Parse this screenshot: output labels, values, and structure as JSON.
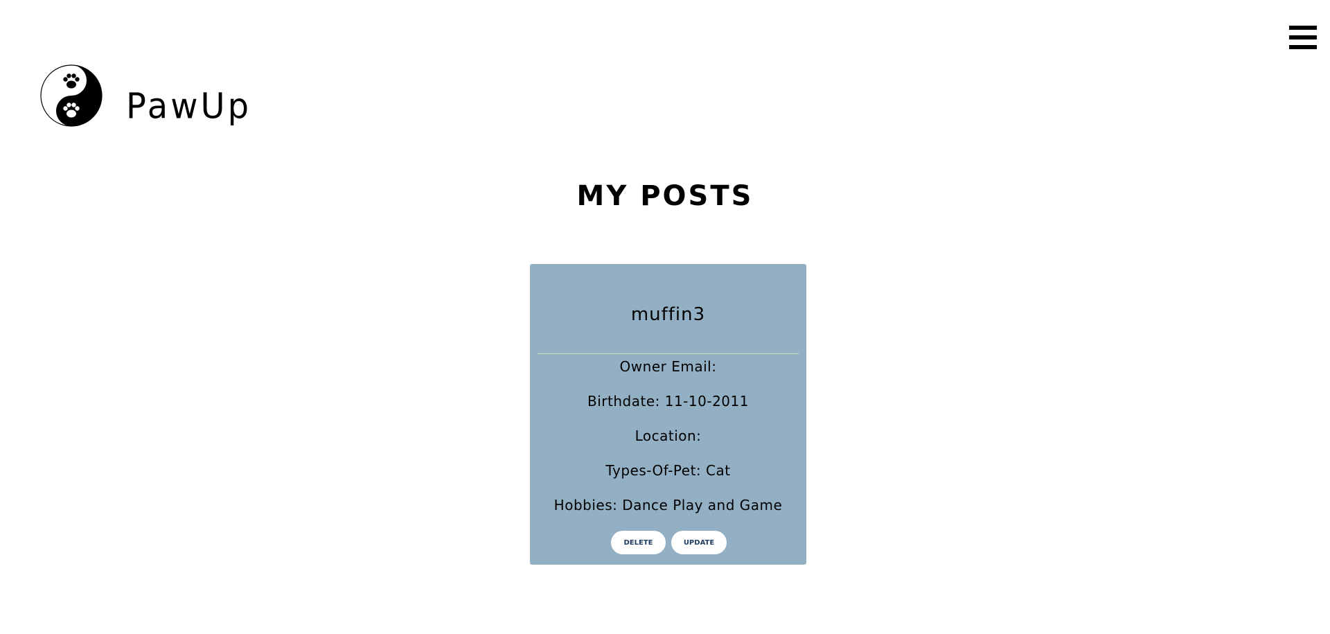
{
  "header": {
    "brand": "PawUp",
    "menu_icon": "hamburger-menu-icon",
    "logo_icon": "yin-yang-paw-logo-icon"
  },
  "page": {
    "title": "MY POSTS"
  },
  "posts": [
    {
      "name": "muffin3",
      "owner_email_label": "Owner Email:",
      "owner_email": "",
      "birthdate_label": "Birthdate: ",
      "birthdate": "11-10-2011",
      "location_label": "Location:",
      "location": "",
      "type_label": "Types-Of-Pet: ",
      "type": "Cat",
      "hobbies_label": "Hobbies: ",
      "hobbies": "Dance Play and Game",
      "delete_label": "DELETE",
      "update_label": "UPDATE"
    }
  ],
  "colors": {
    "card_background": "#93afc3",
    "divider": "#c9e3a6",
    "button_text": "#1f3a5f"
  }
}
